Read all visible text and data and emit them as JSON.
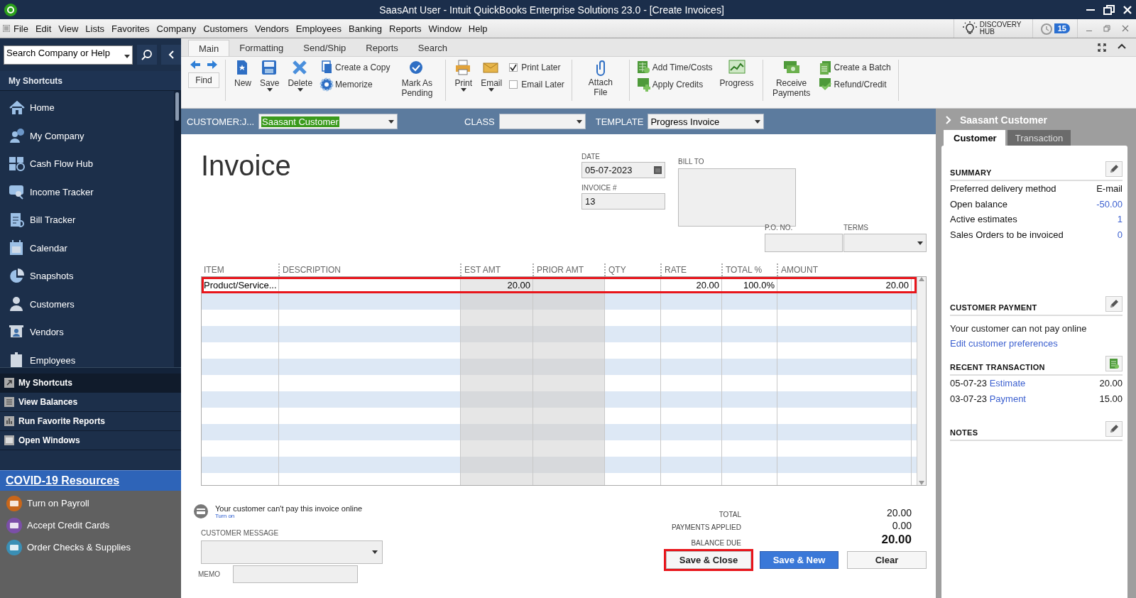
{
  "window": {
    "title": "SaasAnt User  - Intuit QuickBooks Enterprise Solutions 23.0 - [Create Invoices]"
  },
  "menu": [
    {
      "label": "File"
    },
    {
      "label": "Edit"
    },
    {
      "label": "View"
    },
    {
      "label": "Lists"
    },
    {
      "label": "Favorites"
    },
    {
      "label": "Company"
    },
    {
      "label": "Customers"
    },
    {
      "label": "Vendors"
    },
    {
      "label": "Employees"
    },
    {
      "label": "Banking"
    },
    {
      "label": "Reports"
    },
    {
      "label": "Window"
    },
    {
      "label": "Help"
    }
  ],
  "hub": {
    "label": "DISCOVERY HUB",
    "alerts": "15"
  },
  "sidebar": {
    "search": {
      "value": "Search Company or Help"
    },
    "title": "My Shortcuts",
    "items": [
      {
        "label": "Home"
      },
      {
        "label": "My Company"
      },
      {
        "label": "Cash Flow Hub"
      },
      {
        "label": "Income Tracker"
      },
      {
        "label": "Bill Tracker"
      },
      {
        "label": "Calendar"
      },
      {
        "label": "Snapshots"
      },
      {
        "label": "Customers"
      },
      {
        "label": "Vendors"
      },
      {
        "label": "Employees"
      }
    ],
    "nav": [
      {
        "label": "My Shortcuts",
        "selected": true
      },
      {
        "label": "View Balances",
        "selected": false
      },
      {
        "label": "Run Favorite Reports",
        "selected": false
      },
      {
        "label": "Open Windows",
        "selected": false
      }
    ],
    "banner": "COVID-19 Resources",
    "resources": [
      {
        "label": "Turn on Payroll",
        "color": "#c8661a"
      },
      {
        "label": "Accept Credit Cards",
        "color": "#7b4fa8"
      },
      {
        "label": "Order Checks & Supplies",
        "color": "#3a8fb5"
      }
    ]
  },
  "ribbon": {
    "tabs": [
      {
        "label": "Main",
        "selected": true
      },
      {
        "label": "Formatting",
        "selected": false
      },
      {
        "label": "Send/Ship",
        "selected": false
      },
      {
        "label": "Reports",
        "selected": false
      },
      {
        "label": "Search",
        "selected": false
      }
    ],
    "find": "Find",
    "groups": [
      {
        "items": [
          {
            "kind": "big",
            "label": "New",
            "dropdown": false
          },
          {
            "kind": "big",
            "label": "Save",
            "dropdown": true
          },
          {
            "kind": "big",
            "label": "Delete",
            "dropdown": true
          },
          {
            "kind": "stack",
            "items": [
              {
                "label": "Create a Copy"
              },
              {
                "label": "Memorize"
              }
            ]
          },
          {
            "kind": "big",
            "label": "Mark As Pending",
            "dropdown": false
          }
        ]
      },
      {
        "items": [
          {
            "kind": "big",
            "label": "Print",
            "dropdown": true
          },
          {
            "kind": "big",
            "label": "Email",
            "dropdown": true
          },
          {
            "kind": "checks",
            "items": [
              {
                "label": "Print Later",
                "checked": true
              },
              {
                "label": "Email Later",
                "checked": false
              }
            ]
          }
        ]
      },
      {
        "items": [
          {
            "kind": "big",
            "label": "Attach File",
            "dropdown": false
          }
        ]
      },
      {
        "items": [
          {
            "kind": "stack",
            "items": [
              {
                "label": "Add Time/Costs"
              },
              {
                "label": "Apply Credits"
              }
            ]
          },
          {
            "kind": "big",
            "label": "Progress",
            "dropdown": false
          }
        ]
      },
      {
        "items": [
          {
            "kind": "big",
            "label": "Receive Payments",
            "dropdown": false
          },
          {
            "kind": "stack",
            "items": [
              {
                "label": "Create a Batch"
              },
              {
                "label": "Refund/Credit"
              }
            ]
          }
        ]
      }
    ]
  },
  "customer_bar": {
    "customer_label": "CUSTOMER:J...",
    "customer": {
      "value": "Saasant Customer",
      "highlighted": true
    },
    "class_label": "CLASS",
    "template_label": "TEMPLATE",
    "template": {
      "value": "Progress Invoice"
    }
  },
  "invoice": {
    "title": "Invoice",
    "date_label": "DATE",
    "date": "05-07-2023",
    "number_label": "INVOICE #",
    "number": "13",
    "bill_to_label": "BILL TO",
    "po_label": "P.O. NO.",
    "terms_label": "TERMS"
  },
  "table": {
    "columns": [
      "ITEM",
      "DESCRIPTION",
      "EST AMT",
      "PRIOR AMT",
      "QTY",
      "RATE",
      "TOTAL %",
      "AMOUNT"
    ],
    "rows": [
      {
        "item": "Product/Service...",
        "est_amt": "20.00",
        "rate": "20.00",
        "total_pct": "100.0%",
        "amount": "20.00",
        "highlighted": true
      }
    ]
  },
  "footer": {
    "online_note": "Your customer can't pay this invoice online",
    "turn_on": "Turn on",
    "message_label": "CUSTOMER MESSAGE",
    "memo_label": "MEMO",
    "totals": [
      {
        "label": "TOTAL",
        "value": "20.00",
        "kind": "normal"
      },
      {
        "label": "PAYMENTS APPLIED",
        "value": "0.00",
        "kind": "normal"
      },
      {
        "label": "BALANCE DUE",
        "value": "20.00",
        "kind": "emphasis"
      }
    ],
    "buttons": [
      {
        "label": "Save & Close",
        "kind": "default",
        "highlighted": true
      },
      {
        "label": "Save & New",
        "kind": "primary",
        "highlighted": false
      },
      {
        "label": "Clear",
        "kind": "default",
        "highlighted": false
      }
    ]
  },
  "panel": {
    "title": "Saasant Customer",
    "tabs": [
      {
        "label": "Customer",
        "selected": true
      },
      {
        "label": "Transaction",
        "selected": false
      }
    ],
    "summary": {
      "title": "SUMMARY",
      "rows": [
        {
          "label": "Preferred delivery method",
          "value": "E-mail",
          "link": false
        },
        {
          "label": "Open balance",
          "value": "-50.00",
          "link": true
        },
        {
          "label": "Active estimates",
          "value": "1",
          "link": true
        },
        {
          "label": "Sales Orders to be invoiced",
          "value": "0",
          "link": true
        }
      ]
    },
    "payment": {
      "title": "CUSTOMER PAYMENT",
      "note": "Your customer can not pay online",
      "link": "Edit customer preferences"
    },
    "recent": {
      "title": "RECENT TRANSACTION",
      "rows": [
        {
          "date": "05-07-23",
          "type": "Estimate",
          "amount": "20.00"
        },
        {
          "date": "03-07-23",
          "type": "Payment",
          "amount": "15.00"
        }
      ]
    },
    "notes": {
      "title": "NOTES"
    }
  }
}
